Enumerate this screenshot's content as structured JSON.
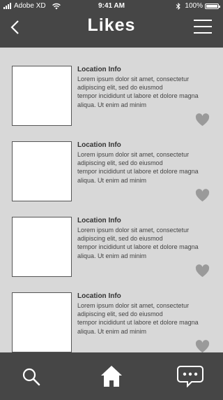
{
  "status_bar": {
    "carrier": "Adobe XD",
    "time": "9:41 AM",
    "battery_text": "100%",
    "battery_level_percent": 100
  },
  "header": {
    "title": "Likes",
    "back_icon": "chevron-left-icon",
    "menu_icon": "hamburger-menu-icon"
  },
  "items": [
    {
      "title": "Location Info",
      "lines": [
        "Lorem ipsum dolor sit amet, consectetur",
        "adipiscing elit, sed do eiusmod",
        "tempor incididunt ut labore et dolore magna",
        "aliqua. Ut enim ad minim"
      ]
    },
    {
      "title": "Location Info",
      "lines": [
        "Lorem ipsum dolor sit amet, consectetur",
        "adipiscing elit, sed do eiusmod",
        "tempor incididunt ut labore et dolore magna",
        "aliqua. Ut enim ad minim"
      ]
    },
    {
      "title": "Location Info",
      "lines": [
        "Lorem ipsum dolor sit amet, consectetur",
        "adipiscing elit, sed do eiusmod",
        "tempor incididunt ut labore et dolore magna",
        "aliqua. Ut enim ad minim"
      ]
    },
    {
      "title": "Location Info",
      "lines": [
        "Lorem ipsum dolor sit amet, consectetur",
        "adipiscing elit, sed do eiusmod",
        "tempor incididunt ut labore et dolore magna",
        "aliqua. Ut enim ad minim"
      ]
    }
  ],
  "tabbar": {
    "tabs": [
      "search-icon",
      "home-icon",
      "chat-icon"
    ]
  },
  "colors": {
    "bar": "#464646",
    "background": "#d8d8d8",
    "heart": "#9a9a9a"
  }
}
